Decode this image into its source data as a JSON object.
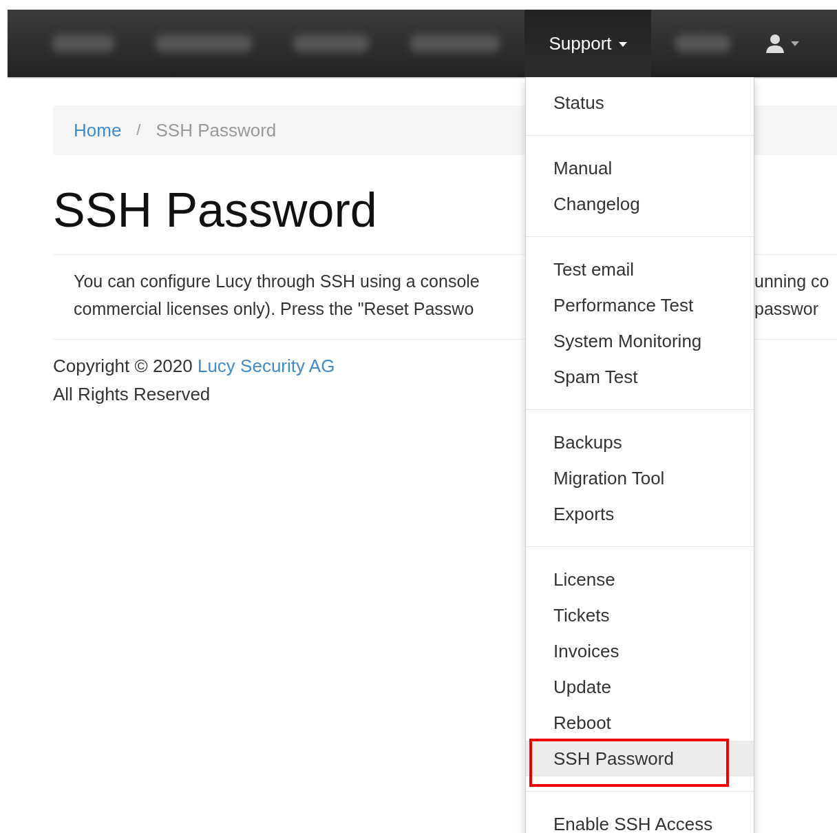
{
  "navbar": {
    "items": [
      {
        "label": "Support",
        "selected": true,
        "caret": true
      }
    ],
    "user_menu": {
      "caret": true
    }
  },
  "breadcrumb": {
    "items": [
      {
        "label": "Home",
        "kind": "link"
      },
      {
        "label": "SSH Password",
        "kind": "current"
      }
    ],
    "separator": "/"
  },
  "title": "SSH Password",
  "paragraph": {
    "left_lines": [
      "You can configure Lucy through SSH using a console",
      "commercial licenses only). Press the \"Reset Passwo"
    ],
    "right_lines": [
      "unning co",
      "passwor"
    ]
  },
  "footer": {
    "copyright": "Copyright © 2020 ",
    "company_link": "Lucy Security AG",
    "rights": "All Rights Reserved"
  },
  "menu": {
    "groups": [
      {
        "items": [
          {
            "label": "Status",
            "selected": false
          }
        ]
      },
      {
        "items": [
          {
            "label": "Manual",
            "selected": false
          },
          {
            "label": "Changelog",
            "selected": false
          }
        ]
      },
      {
        "items": [
          {
            "label": "Test email",
            "selected": false
          },
          {
            "label": "Performance Test",
            "selected": false
          },
          {
            "label": "System Monitoring",
            "selected": false
          },
          {
            "label": "Spam Test",
            "selected": false
          }
        ]
      },
      {
        "items": [
          {
            "label": "Backups",
            "selected": false
          },
          {
            "label": "Migration Tool",
            "selected": false
          },
          {
            "label": "Exports",
            "selected": false
          }
        ]
      },
      {
        "items": [
          {
            "label": "License",
            "selected": false
          },
          {
            "label": "Tickets",
            "selected": false
          },
          {
            "label": "Invoices",
            "selected": false
          },
          {
            "label": "Update",
            "selected": false
          },
          {
            "label": "Reboot",
            "selected": false
          },
          {
            "label": "SSH Password",
            "selected": true
          }
        ]
      },
      {
        "items": [
          {
            "label": "Enable SSH Access",
            "selected": false
          }
        ]
      }
    ]
  }
}
